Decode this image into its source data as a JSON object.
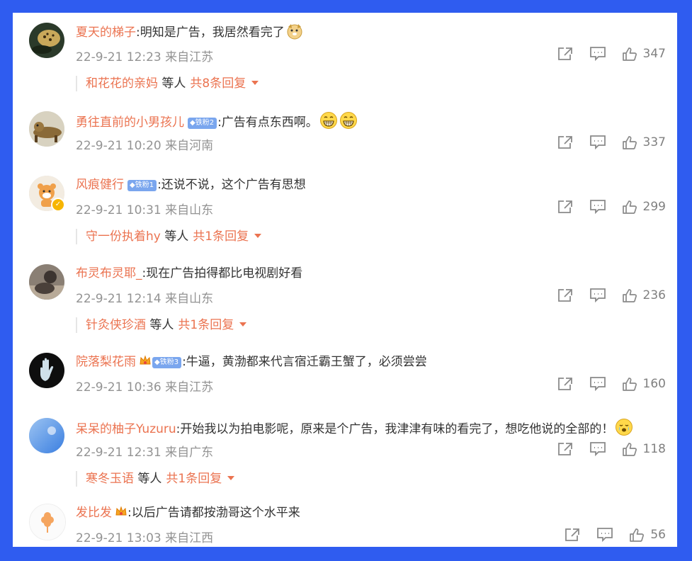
{
  "comments": [
    {
      "user": "夏天的梯子",
      "text": ":明知是广告，我居然看完了",
      "emoji": "doge-emoji",
      "time": "22-9-21 12:23 来自江苏",
      "likes": "347",
      "reply": {
        "who": "和花花的亲妈",
        "mid": " 等人",
        "more": "共8条回复"
      }
    },
    {
      "user": "勇往直前的小男孩儿",
      "badge": "铁粉2",
      "text": ":广告有点东西啊。",
      "emoji": "grin-emoji",
      "time": "22-9-21 10:20 来自河南",
      "likes": "337"
    },
    {
      "user": "风痕健行",
      "badge": "铁粉1",
      "text": ":还说不说，这个广告有思想",
      "time": "22-9-21 10:31 来自山东",
      "likes": "299",
      "reply": {
        "who": "守一份执着hy",
        "mid": " 等人",
        "more": "共1条回复"
      }
    },
    {
      "user": "布灵布灵耶_",
      "text": ":现在广告拍得都比电视剧好看",
      "time": "22-9-21 12:14 来自山东",
      "likes": "236",
      "reply": {
        "who": "针灸侠珍酒",
        "mid": " 等人",
        "more": "共1条回复"
      }
    },
    {
      "user": "院落梨花雨",
      "badge": "铁粉3",
      "text": ":牛逼，黄渤都来代言宿迁霸王蟹了，必须尝尝",
      "time": "22-9-21 10:36 来自江苏",
      "likes": "160"
    },
    {
      "user": "呆呆的柚子Yuzuru",
      "text": ":开始我以为拍电影呢，原来是个广告，我津津有味的看完了，想吃他说的全部的！",
      "emoji": "tears-emoji",
      "time": "22-9-21 12:31 来自广东",
      "likes": "118",
      "reply": {
        "who": "寒冬玉语",
        "mid": " 等人",
        "more": "共1条回复"
      }
    },
    {
      "user": "发比发",
      "text": ":以后广告请都按渤哥这个水平来",
      "time": "22-9-21 13:03 来自江西",
      "likes": "56"
    }
  ],
  "colors": {
    "accent": "#eb7350",
    "frame": "#2f5cf0",
    "badge": "#7aa6ee"
  }
}
